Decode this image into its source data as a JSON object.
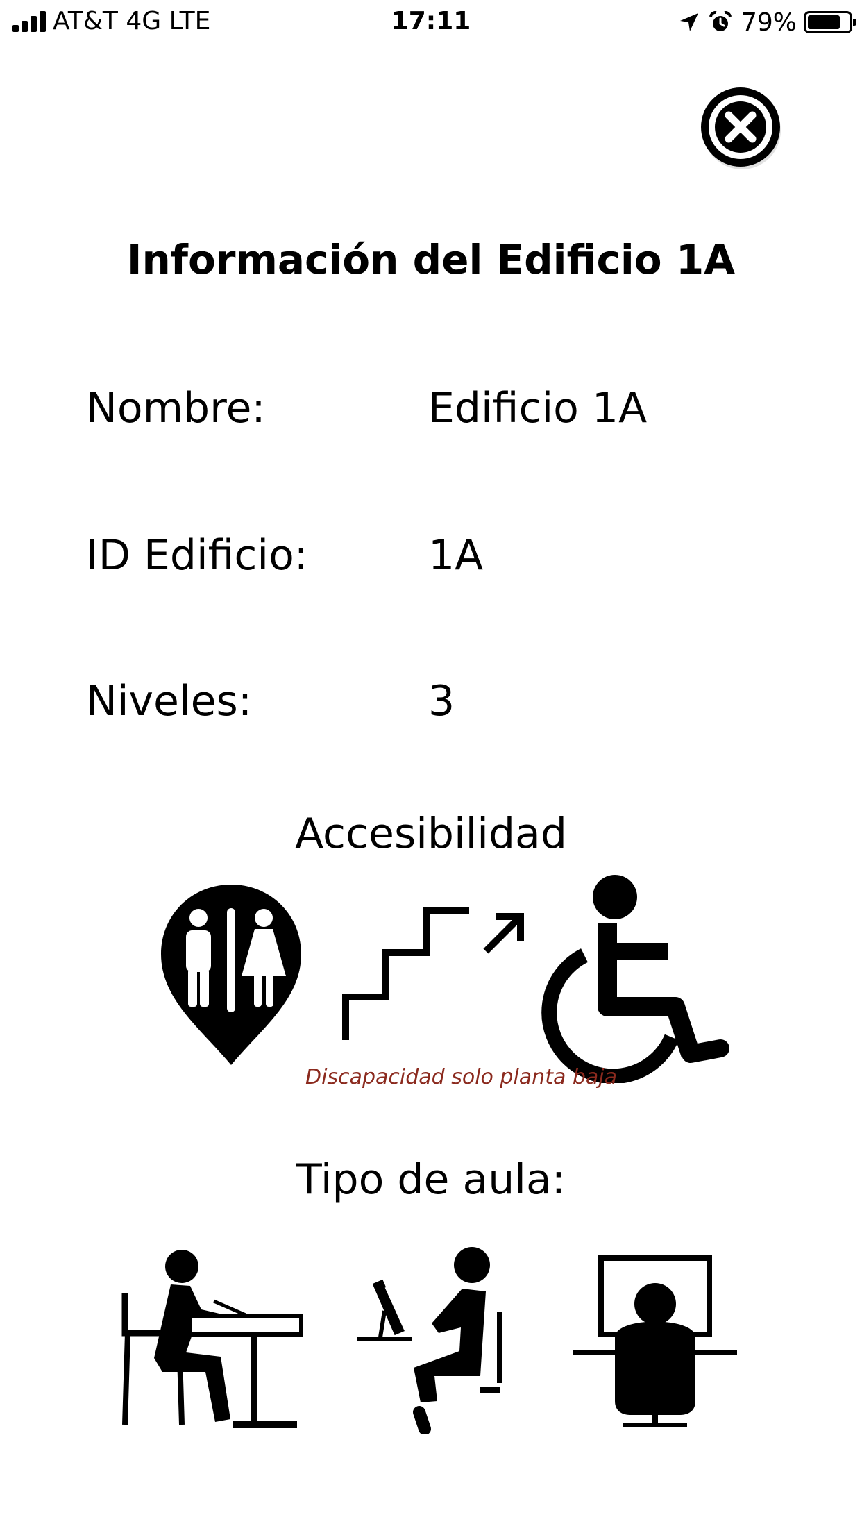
{
  "status_bar": {
    "carrier": "AT&T 4G  LTE",
    "time": "17:11",
    "battery": "79%",
    "battery_level": 0.79,
    "icons": [
      "cellular-signal-icon",
      "location-arrow-icon",
      "alarm-clock-icon",
      "battery-icon"
    ]
  },
  "close_icon": "close-icon",
  "title": "Información del Edificio 1A",
  "info": {
    "name_label": "Nombre:",
    "name_value": "Edificio 1A",
    "id_label": "ID Edificio:",
    "id_value": "1A",
    "levels_label": "Niveles:",
    "levels_value": "3"
  },
  "accessibility": {
    "title": "Accesibilidad",
    "icons": [
      "restroom-pin-icon",
      "stairs-up-icon",
      "wheelchair-icon"
    ],
    "note": "Discapacidad solo planta baja",
    "note_color": "#8b2a1e"
  },
  "classroom": {
    "title": "Tipo de aula:",
    "icons": [
      "student-desk-icon",
      "computer-lab-icon",
      "desktop-workstation-icon"
    ]
  }
}
